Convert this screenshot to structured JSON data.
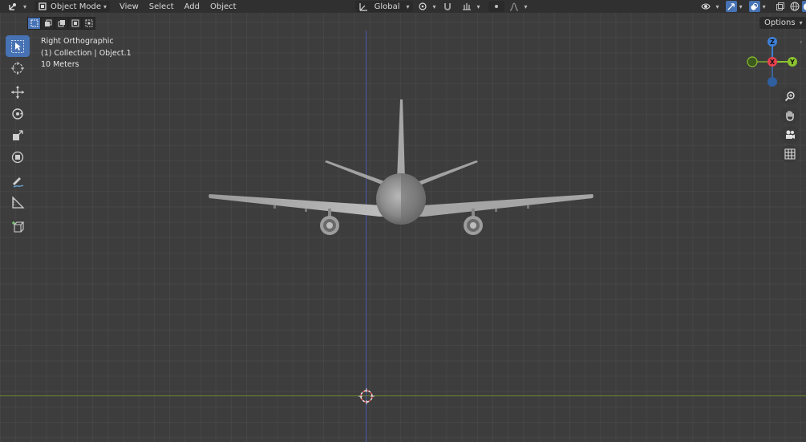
{
  "header": {
    "mode_label": "Object Mode",
    "menus": [
      "View",
      "Select",
      "Add",
      "Object"
    ],
    "transform_orientation": "Global",
    "options_label": "Options"
  },
  "viewport_info": {
    "view_name": "Right Orthographic",
    "collection": "(1) Collection | Object.1",
    "scale": "10 Meters"
  },
  "gizmo": {
    "z_label": "Z",
    "x_label": "X",
    "y_label": "Y",
    "colors": {
      "x": "#e8414e",
      "y": "#8bc230",
      "z": "#3d7fd6"
    }
  },
  "tools": [
    {
      "name": "select-box-tool",
      "active": true
    },
    {
      "name": "cursor-tool",
      "active": false
    },
    {
      "name": "move-tool",
      "active": false
    },
    {
      "name": "rotate-tool",
      "active": false
    },
    {
      "name": "scale-tool",
      "active": false
    },
    {
      "name": "transform-tool",
      "active": false
    },
    {
      "name": "annotate-tool",
      "active": false
    },
    {
      "name": "measure-tool",
      "active": false
    },
    {
      "name": "add-cube-tool",
      "active": false
    }
  ],
  "colors": {
    "accent": "#4772b3",
    "header_bg": "#303030",
    "viewport_bg": "#3d3d3d",
    "axis_green": "#6d8a2c",
    "axis_blue": "#4a5bb0"
  }
}
